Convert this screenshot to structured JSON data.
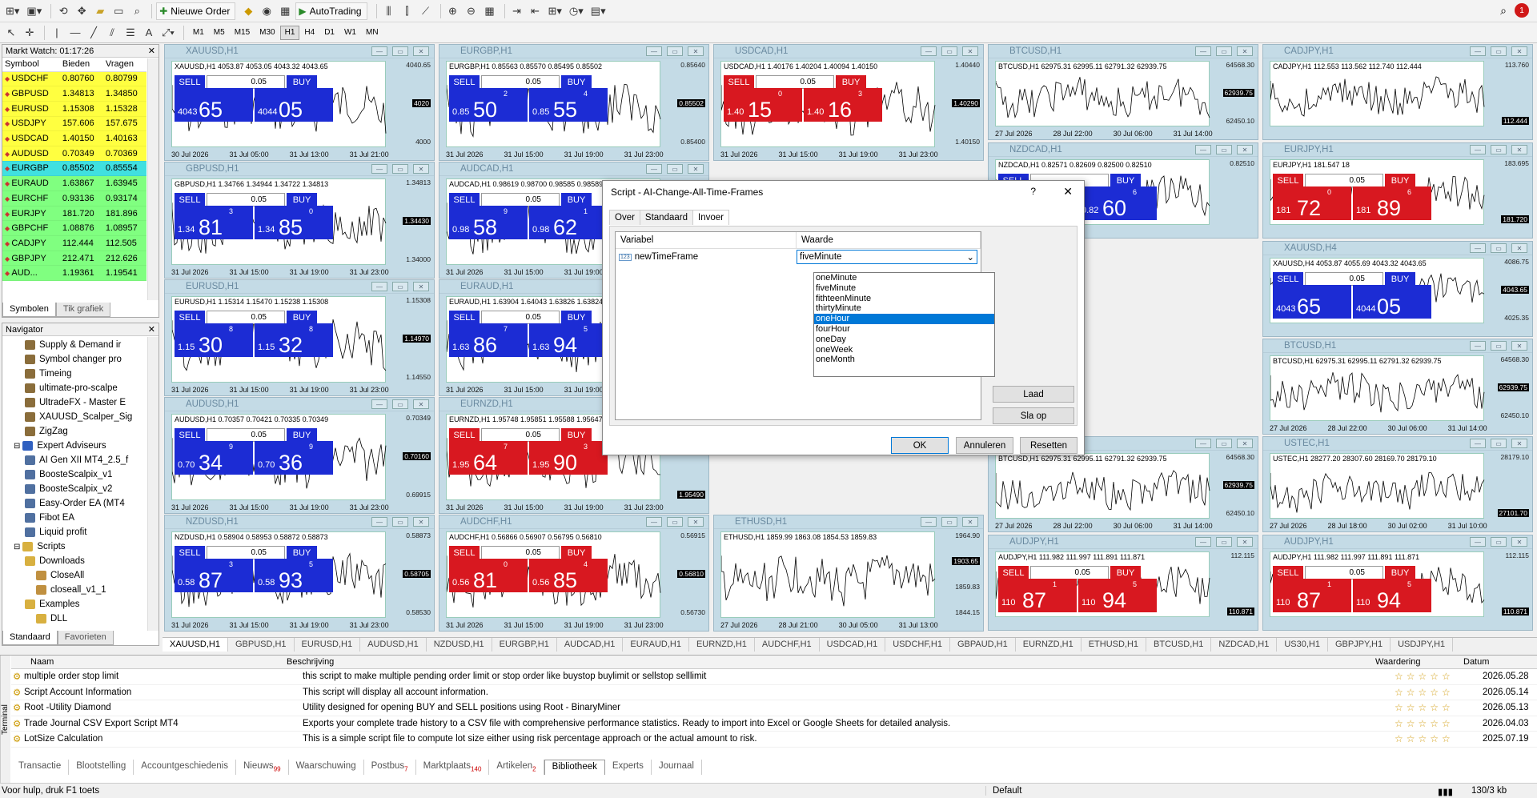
{
  "toolbar": {
    "new_order": "Nieuwe Order",
    "autotrading": "AutoTrading",
    "timeframes": [
      "M1",
      "M5",
      "M15",
      "M30",
      "H1",
      "H4",
      "D1",
      "W1",
      "MN"
    ],
    "active_tf": "H1",
    "alerts": "1"
  },
  "market_watch": {
    "title": "Markt Watch: 01:17:26",
    "cols": [
      "Symbool",
      "Bieden",
      "Vragen"
    ],
    "rows": [
      {
        "s": "USDCHF",
        "b": "0.80760",
        "a": "0.80799",
        "c": "#ffff40"
      },
      {
        "s": "GBPUSD",
        "b": "1.34813",
        "a": "1.34850",
        "c": "#ffff40"
      },
      {
        "s": "EURUSD",
        "b": "1.15308",
        "a": "1.15328",
        "c": "#ffff40"
      },
      {
        "s": "USDJPY",
        "b": "157.606",
        "a": "157.675",
        "c": "#ffff40"
      },
      {
        "s": "USDCAD",
        "b": "1.40150",
        "a": "1.40163",
        "c": "#ffff40"
      },
      {
        "s": "AUDUSD",
        "b": "0.70349",
        "a": "0.70369",
        "c": "#ffff40"
      },
      {
        "s": "EURGBP",
        "b": "0.85502",
        "a": "0.85554",
        "c": "#40e0e0"
      },
      {
        "s": "EURAUD",
        "b": "1.63867",
        "a": "1.63945",
        "c": "#80ff80"
      },
      {
        "s": "EURCHF",
        "b": "0.93136",
        "a": "0.93174",
        "c": "#80ff80"
      },
      {
        "s": "EURJPY",
        "b": "181.720",
        "a": "181.896",
        "c": "#80ff80"
      },
      {
        "s": "GBPCHF",
        "b": "1.08876",
        "a": "1.08957",
        "c": "#80ff80"
      },
      {
        "s": "CADJPY",
        "b": "112.444",
        "a": "112.505",
        "c": "#80ff80"
      },
      {
        "s": "GBPJPY",
        "b": "212.471",
        "a": "212.626",
        "c": "#80ff80"
      },
      {
        "s": "AUD...",
        "b": "1.19361",
        "a": "1.19541",
        "c": "#80ff80"
      }
    ],
    "tabs": [
      "Symbolen",
      "Tik grafiek"
    ]
  },
  "navigator": {
    "title": "Navigator",
    "items": [
      {
        "t": "Supply & Demand ir",
        "l": 2,
        "c": "#8a6d3b"
      },
      {
        "t": "Symbol changer pro",
        "l": 2,
        "c": "#8a6d3b"
      },
      {
        "t": "Timeing",
        "l": 2,
        "c": "#8a6d3b"
      },
      {
        "t": "ultimate-pro-scalpe",
        "l": 2,
        "c": "#8a6d3b"
      },
      {
        "t": "UltradeFX - Master E",
        "l": 2,
        "c": "#8a6d3b"
      },
      {
        "t": "XAUUSD_Scalper_Sig",
        "l": 2,
        "c": "#8a6d3b"
      },
      {
        "t": "ZigZag",
        "l": 2,
        "c": "#8a6d3b"
      },
      {
        "t": "Expert Adviseurs",
        "l": 1,
        "c": "#3060c0"
      },
      {
        "t": "AI Gen XII MT4_2.5_f",
        "l": 2,
        "c": "#5070a0"
      },
      {
        "t": "BoosteScalpix_v1",
        "l": 2,
        "c": "#5070a0"
      },
      {
        "t": "BoosteScalpix_v2",
        "l": 2,
        "c": "#5070a0"
      },
      {
        "t": "Easy-Order EA (MT4",
        "l": 2,
        "c": "#5070a0"
      },
      {
        "t": "Fibot EA",
        "l": 2,
        "c": "#5070a0"
      },
      {
        "t": "Liquid profit",
        "l": 2,
        "c": "#5070a0"
      },
      {
        "t": "Scripts",
        "l": 1,
        "c": "#d8b040"
      },
      {
        "t": "Downloads",
        "l": 2,
        "c": "#d8b040"
      },
      {
        "t": "CloseAll",
        "l": 3,
        "c": "#c09040"
      },
      {
        "t": "closeall_v1_1",
        "l": 3,
        "c": "#c09040"
      },
      {
        "t": "Examples",
        "l": 2,
        "c": "#d8b040"
      },
      {
        "t": "DLL",
        "l": 3,
        "c": "#d8b040"
      }
    ],
    "tabs": [
      "Standaard",
      "Favorieten"
    ]
  },
  "charts": [
    {
      "t": "XAUUSD,H1",
      "sym": "XAUUSD,H1 4053.87 4053.05 4043.32 4043.65",
      "red": false,
      "s1": "4043",
      "s2": "65",
      "b1": "4044",
      "b2": "05",
      "sm": "",
      "lot": "0.05",
      "ax": [
        "4040.65",
        "4020",
        "4000"
      ],
      "x": [
        "30 Jul 2026",
        "31 Jul 05:00",
        "31 Jul 13:00",
        "31 Jul 21:00"
      ]
    },
    {
      "t": "EURGBP,H1",
      "sym": "EURGBP,H1 0.85563 0.85570 0.85495 0.85502",
      "red": false,
      "s1": "0.85",
      "s2": "50",
      "b1": "0.85",
      "b2": "55",
      "sup1": "2",
      "sup2": "4",
      "lot": "0.05",
      "ax": [
        "0.85640",
        "0.85502",
        "0.85400"
      ],
      "x": [
        "31 Jul 2026",
        "31 Jul 15:00",
        "31 Jul 19:00",
        "31 Jul 23:00"
      ]
    },
    {
      "t": "USDCAD,H1",
      "sym": "USDCAD,H1 1.40176 1.40204 1.40094 1.40150",
      "red": true,
      "s1": "1.40",
      "s2": "15",
      "b1": "1.40",
      "b2": "16",
      "sup1": "0",
      "sup2": "3",
      "lot": "0.05",
      "ax": [
        "1.40440",
        "1.40290",
        "1.40150"
      ],
      "x": [
        "31 Jul 2026",
        "31 Jul 15:00",
        "31 Jul 19:00",
        "31 Jul 23:00"
      ]
    },
    {
      "t": "BTCUSD,H1",
      "sym": "BTCUSD,H1 62975.31 62995.11 62791.32 62939.75",
      "line": true,
      "ax": [
        "64568.30",
        "62939.75",
        "62450.10"
      ],
      "x": [
        "27 Jul 2026",
        "28 Jul 22:00",
        "30 Jul 06:00",
        "31 Jul 14:00"
      ]
    },
    {
      "t": "CADJPY,H1",
      "sym": "CADJPY,H1 112.553 113.562 112.740 112.444",
      "red": true,
      "s1": "",
      "s2": "",
      "b1": "",
      "b2": "",
      "lot": "",
      "ax": [
        "113.760",
        "112.444"
      ],
      "x": [],
      "nobox": true
    },
    {
      "t": "GBPUSD,H1",
      "sym": "GBPUSD,H1 1.34766 1.34944 1.34722 1.34813",
      "red": false,
      "s1": "1.34",
      "s2": "81",
      "b1": "1.34",
      "b2": "85",
      "sup1": "3",
      "sup2": "0",
      "lot": "0.05",
      "ax": [
        "1.34813",
        "1.34430",
        "1.34000"
      ],
      "x": [
        "31 Jul 2026",
        "31 Jul 15:00",
        "31 Jul 19:00",
        "31 Jul 23:00"
      ]
    },
    {
      "t": "AUDCAD,H1",
      "sym": "AUDCAD,H1 0.98619 0.98700 0.98585 0.98589",
      "red": false,
      "s1": "0.98",
      "s2": "58",
      "b1": "0.98",
      "b2": "62",
      "sup1": "9",
      "sup2": "1",
      "lot": "0.05",
      "ax": [],
      "x": [
        "31 Jul 2026",
        "31 Jul 15:00",
        "31 Jul 19:00"
      ]
    },
    {
      "t": "NZDCAD,H1",
      "sym": "NZDCAD,H1 0.82571 0.82609 0.82500 0.82510",
      "red": false,
      "s1": "",
      "s2": "",
      "b1": "0.82",
      "b2": "60",
      "sup2": "6",
      "lot": "",
      "ax": [
        "0.82510"
      ],
      "x": []
    },
    {
      "t": "EURJPY,H1",
      "sym": "EURJPY,H1 181.547 18",
      "red": true,
      "s1": "181",
      "s2": "72",
      "b1": "181",
      "b2": "89",
      "sup1": "0",
      "sup2": "6",
      "lot": "0.05",
      "ax": [
        "183.695",
        "181.720"
      ],
      "x": []
    },
    {
      "t": "EURUSD,H1",
      "sym": "EURUSD,H1 1.15314 1.15470 1.15238 1.15308",
      "red": false,
      "s1": "1.15",
      "s2": "30",
      "b1": "1.15",
      "b2": "32",
      "sup1": "8",
      "sup2": "8",
      "lot": "0.05",
      "ax": [
        "1.15308",
        "1.14970",
        "1.14550"
      ],
      "x": [
        "31 Jul 2026",
        "31 Jul 15:00",
        "31 Jul 19:00",
        "31 Jul 23:00"
      ]
    },
    {
      "t": "EURAUD,H1",
      "sym": "EURAUD,H1 1.63904 1.64043 1.63826 1.63824",
      "red": false,
      "s1": "1.63",
      "s2": "86",
      "b1": "1.63",
      "b2": "94",
      "sup1": "7",
      "sup2": "5",
      "lot": "0.05",
      "ax": [],
      "x": [
        "31 Jul 2026",
        "31 Jul 15:00",
        "31 Jul 19:00"
      ]
    },
    {
      "t": "XAUUSD,H4",
      "sym": "XAUUSD,H4 4053.87 4055.69 4043.32 4043.65",
      "red": false,
      "s1": "4043",
      "s2": "65",
      "b1": "4044",
      "b2": "05",
      "lot": "0.05",
      "ax": [
        "4086.75",
        "4043.65",
        "4025.35"
      ],
      "x": []
    },
    {
      "t": "AUDUSD,H1",
      "sym": "AUDUSD,H1 0.70357 0.70421 0.70335 0.70349",
      "red": false,
      "s1": "0.70",
      "s2": "34",
      "b1": "0.70",
      "b2": "36",
      "sup1": "9",
      "sup2": "9",
      "lot": "0.05",
      "ax": [
        "0.70349",
        "0.70160",
        "0.69915"
      ],
      "x": [
        "31 Jul 2026",
        "31 Jul 15:00",
        "31 Jul 19:00",
        "31 Jul 23:00"
      ]
    },
    {
      "t": "EURNZD,H1",
      "sym": "EURNZD,H1 1.95748 1.95851 1.95588 1.95647",
      "red": true,
      "s1": "1.95",
      "s2": "64",
      "b1": "1.95",
      "b2": "90",
      "sup1": "7",
      "sup2": "3",
      "lot": "0.05",
      "ax": [
        "1.95647",
        "1.95490"
      ],
      "x": [
        "31 Jul 2026",
        "31 Jul 15:00",
        "31 Jul 19:00",
        "31 Jul 23:00"
      ]
    },
    {
      "t": "BTCUSD,H1",
      "sym": "BTCUSD,H1 62975.31 62995.11 62791.32 62939.75",
      "line": true,
      "ax": [
        "64568.30",
        "62939.75",
        "62450.10"
      ],
      "x": [
        "27 Jul 2026",
        "28 Jul 22:00",
        "30 Jul 06:00",
        "31 Jul 14:00"
      ]
    },
    {
      "t": "NZDUSD,H1",
      "sym": "NZDUSD,H1 0.58904 0.58953 0.58872 0.58873",
      "red": false,
      "s1": "0.58",
      "s2": "87",
      "b1": "0.58",
      "b2": "93",
      "sup1": "3",
      "sup2": "5",
      "lot": "0.05",
      "ax": [
        "0.58873",
        "0.58705",
        "0.58530"
      ],
      "x": [
        "31 Jul 2026",
        "31 Jul 15:00",
        "31 Jul 19:00",
        "31 Jul 23:00"
      ]
    },
    {
      "t": "AUDCHF,H1",
      "sym": "AUDCHF,H1 0.56866 0.56907 0.56795 0.56810",
      "red": true,
      "s1": "0.56",
      "s2": "81",
      "b1": "0.56",
      "b2": "85",
      "sup1": "0",
      "sup2": "4",
      "lot": "0.05",
      "ax": [
        "0.56915",
        "0.56810",
        "0.56730"
      ],
      "x": [
        "31 Jul 2026",
        "31 Jul 15:00",
        "31 Jul 19:00",
        "31 Jul 23:00"
      ]
    },
    {
      "t": "ETHUSD,H1",
      "sym": "ETHUSD,H1 1859.99 1863.08 1854.53 1859.83",
      "line": true,
      "ax": [
        "1964.90",
        "1903.65",
        "1859.83",
        "1844.15"
      ],
      "x": [
        "27 Jul 2026",
        "28 Jul 21:00",
        "30 Jul 05:00",
        "31 Jul 13:00"
      ]
    },
    {
      "t": "AUDJPY,H1",
      "sym": "AUDJPY,H1 111.982 111.997 111.891 111.871",
      "red": true,
      "s1": "110",
      "s2": "87",
      "b1": "110",
      "b2": "94",
      "sup1": "1",
      "sup2": "5",
      "lot": "0.05",
      "ax": [
        "112.115",
        "110.871"
      ],
      "x": []
    },
    {
      "t": "AUDJPY,H1",
      "sym": "AUDJPY,H1 111.982 111.997 111.891 111.871",
      "red": true,
      "s1": "110",
      "s2": "87",
      "b1": "110",
      "b2": "94",
      "sup1": "1",
      "sup2": "5",
      "lot": "0.05",
      "ax": [
        "112.115",
        "110.871"
      ],
      "x": []
    },
    {
      "t": "BTCUSD,H1",
      "sym": "BTCUSD,H1 62975.31 62995.11 62791.32 62939.75",
      "line": true,
      "ax": [
        "64568.30",
        "62939.75",
        "62450.10"
      ],
      "x": [
        "27 Jul 2026",
        "28 Jul 22:00",
        "30 Jul 06:00",
        "31 Jul 14:00"
      ]
    },
    {
      "t": "USTEC,H1",
      "sym": "USTEC,H1 28277.20 28307.60 28169.70 28179.10",
      "line": true,
      "ax": [
        "28179.10",
        "27101.70"
      ],
      "x": [
        "27 Jul 2026",
        "28 Jul 18:00",
        "30 Jul 02:00",
        "31 Jul 10:00"
      ]
    }
  ],
  "chart_tabs": [
    "XAUUSD,H1",
    "GBPUSD,H1",
    "EURUSD,H1",
    "AUDUSD,H1",
    "NZDUSD,H1",
    "EURGBP,H1",
    "AUDCAD,H1",
    "EURAUD,H1",
    "EURNZD,H1",
    "AUDCHF,H1",
    "USDCAD,H1",
    "USDCHF,H1",
    "GBPAUD,H1",
    "EURNZD,H1",
    "ETHUSD,H1",
    "BTCUSD,H1",
    "NZDCAD,H1",
    "US30,H1",
    "GBPJPY,H1",
    "USDJPY,H1"
  ],
  "dialog": {
    "title": "Script - AI-Change-All-Time-Frames",
    "help": "?",
    "close": "✕",
    "tabs": [
      "Over",
      "Standaard",
      "Invoer"
    ],
    "col_var": "Variabel",
    "col_val": "Waarde",
    "var": "newTimeFrame",
    "val": "fiveMinute",
    "options": [
      "oneMinute",
      "fiveMinute",
      "fithteenMinute",
      "thirtyMinute",
      "oneHour",
      "fourHour",
      "oneDay",
      "oneWeek",
      "oneMonth"
    ],
    "selected": "oneHour",
    "btn_load": "Laad",
    "btn_save": "Sla op",
    "btn_ok": "OK",
    "btn_cancel": "Annuleren",
    "btn_reset": "Resetten"
  },
  "terminal": {
    "cols": [
      "Naam",
      "Beschrijving",
      "Waardering",
      "Datum"
    ],
    "rows": [
      {
        "n": "multiple order stop limit",
        "d": "this script to make multiple pending order limit or stop order like buystop buylimit or sellstop selllimit",
        "dt": "2026.05.28"
      },
      {
        "n": "Script Account Information",
        "d": "This script will display all account information.",
        "dt": "2026.05.14"
      },
      {
        "n": "Root -Utility Diamond",
        "d": "Utility designed for opening BUY and SELL positions using Root - BinaryMiner",
        "dt": "2026.05.13"
      },
      {
        "n": "Trade Journal CSV Export Script MT4",
        "d": "Exports your complete trade history to a CSV file with comprehensive performance statistics. Ready to import into Excel or Google Sheets for detailed analysis.",
        "dt": "2026.04.03"
      },
      {
        "n": "LotSize Calculation",
        "d": "This is a simple script file to compute lot size either using risk percentage approach or the actual amount to risk.",
        "dt": "2025.07.19"
      }
    ],
    "tabs": [
      {
        "t": "Transactie"
      },
      {
        "t": "Blootstelling"
      },
      {
        "t": "Accountgeschiedenis"
      },
      {
        "t": "Nieuws",
        "b": "99"
      },
      {
        "t": "Waarschuwing"
      },
      {
        "t": "Postbus",
        "b": "7"
      },
      {
        "t": "Marktplaats",
        "b": "140"
      },
      {
        "t": "Artikelen",
        "b": "2"
      },
      {
        "t": "Bibliotheek",
        "on": true
      },
      {
        "t": "Experts"
      },
      {
        "t": "Journaal"
      }
    ],
    "side": "Terminal"
  },
  "status": {
    "help": "Voor hulp, druk F1 toets",
    "profile": "Default",
    "traffic": "130/3 kb"
  }
}
